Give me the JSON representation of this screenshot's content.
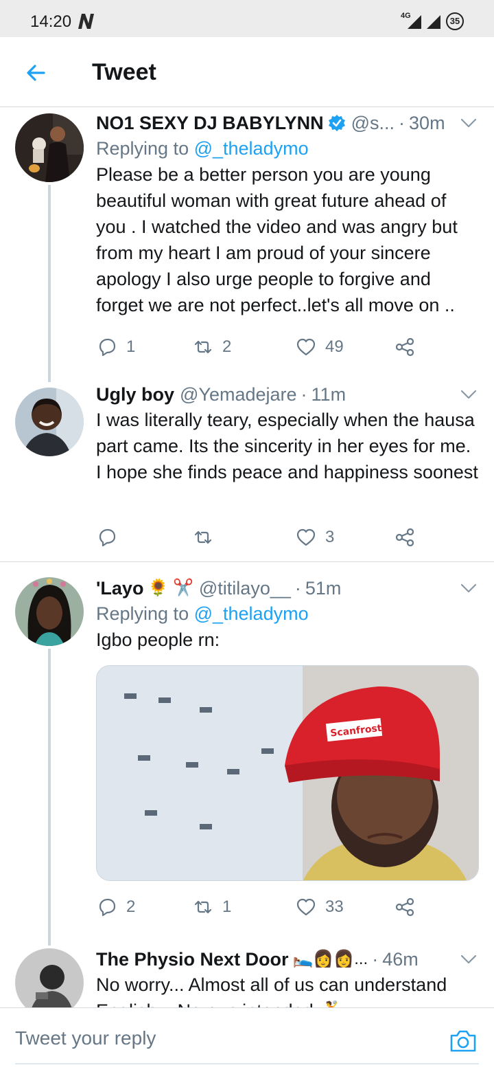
{
  "status_bar": {
    "time": "14:20",
    "network": "4G",
    "battery": "35"
  },
  "header": {
    "title": "Tweet"
  },
  "tweets": [
    {
      "name": "NO1 SEXY DJ BABYLYNN",
      "verified": true,
      "handle": "@s...",
      "time": "30m",
      "replying_prefix": "Replying to ",
      "replying_to": "@_theladymo",
      "text": "Please be a better person you are young beautiful woman with great future ahead of you . I watched the video and was angry but from my heart I am proud of your sincere apology  I also urge people to forgive and forget we are not perfect..let's all move on ..",
      "replies": "1",
      "retweets": "2",
      "likes": "49"
    },
    {
      "name": "Ugly boy",
      "handle": "@Yemadejare",
      "time": "11m",
      "text": "I was literally teary, especially when the hausa part came. Its the sincerity in her eyes for me. I hope she finds peace and happiness soonest",
      "replies": "",
      "retweets": "",
      "likes": "3"
    },
    {
      "name": "'Layo",
      "emojis": "🌻 ✂️",
      "handle": "@titilayo__",
      "time": "51m",
      "replying_prefix": "Replying to ",
      "replying_to": "@_theladymo",
      "text": "Igbo people rn:",
      "media_cap_text": "Scanfrost",
      "replies": "2",
      "retweets": "1",
      "likes": "33"
    },
    {
      "name": "The Physio Next Door",
      "emojis": "🛌👩‍👩...",
      "time": "46m",
      "text": "No worry... Almost all of us can understand English... No pun intended 🤾"
    }
  ],
  "reply_bar": {
    "placeholder": "Tweet your reply"
  },
  "colors": {
    "accent": "#1da1f2",
    "muted": "#657786",
    "text": "#14171a",
    "divider": "#d6dbe0"
  },
  "icons": [
    "back-arrow-icon",
    "verified-icon",
    "chevron-down-icon",
    "reply-icon",
    "retweet-icon",
    "like-icon",
    "share-icon",
    "camera-icon"
  ]
}
